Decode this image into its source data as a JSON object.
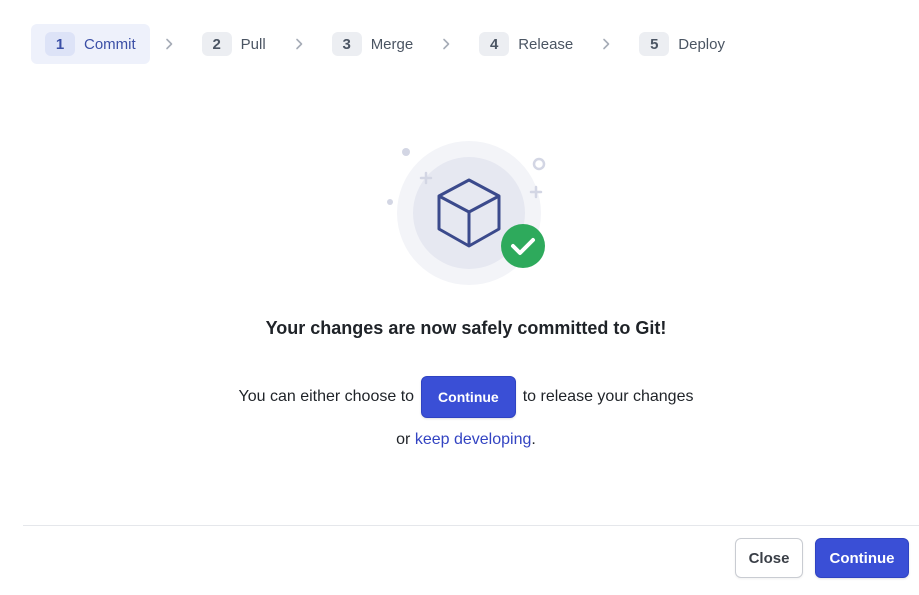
{
  "stepper": {
    "steps": [
      {
        "number": "1",
        "label": "Commit",
        "active": true
      },
      {
        "number": "2",
        "label": "Pull",
        "active": false
      },
      {
        "number": "3",
        "label": "Merge",
        "active": false
      },
      {
        "number": "4",
        "label": "Release",
        "active": false
      },
      {
        "number": "5",
        "label": "Deploy",
        "active": false
      }
    ]
  },
  "illustration": {
    "icon": "box-icon",
    "badge_icon": "check-icon",
    "badge_color": "#2eaa5c",
    "accent_color": "#3b4a8c"
  },
  "main": {
    "headline": "Your changes are now safely committed to Git!",
    "line1_before": "You can either choose to",
    "inline_button_label": "Continue",
    "line1_after": "to release your changes",
    "line2_before": "or",
    "link_label": "keep developing",
    "line2_after": "."
  },
  "footer": {
    "close_label": "Close",
    "continue_label": "Continue"
  },
  "colors": {
    "primary": "#3a4fd6",
    "link": "#3344c2"
  }
}
